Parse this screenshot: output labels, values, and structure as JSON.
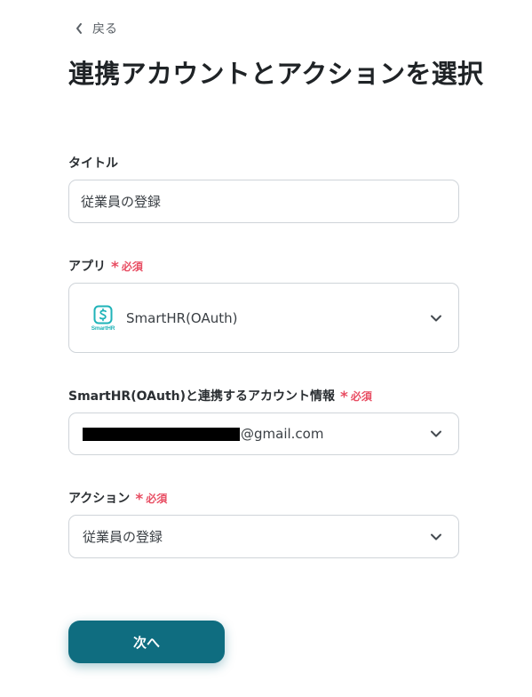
{
  "nav": {
    "back_label": "戻る"
  },
  "page": {
    "title": "連携アカウントとアクションを選択"
  },
  "form": {
    "title_field": {
      "label": "タイトル",
      "value": "従業員の登録"
    },
    "app_field": {
      "label": "アプリ",
      "required": "必須",
      "value": "SmartHR(OAuth)",
      "logo_text": "SmartHR",
      "logo_color": "#1fb3b8"
    },
    "account_field": {
      "label": "SmartHR(OAuth)と連携するアカウント情報",
      "required": "必須",
      "value_suffix": "@gmail.com"
    },
    "action_field": {
      "label": "アクション",
      "required": "必須",
      "value": "従業員の登録"
    }
  },
  "footer": {
    "next_label": "次へ"
  },
  "colors": {
    "accent": "#0f6d80",
    "required": "#e84e63",
    "border": "#cfd4d9"
  },
  "icons": [
    "chevron-left-icon",
    "chevron-down-icon",
    "smarthr-logo-icon",
    "required-asterisk-icon"
  ]
}
